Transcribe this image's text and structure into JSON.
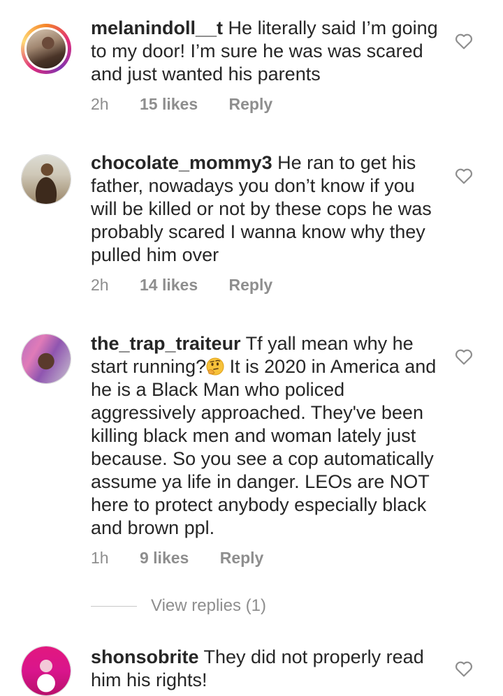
{
  "comments": [
    {
      "username": "melanindoll__t",
      "text": " He literally said I’m going to my door! I’m sure he was was scared and just wanted his parents",
      "time": "2h",
      "likes": "15 likes",
      "reply": "Reply",
      "avatar": "avatar-photo-story-ring"
    },
    {
      "username": "chocolate_mommy3",
      "text": " He ran to get his father, nowadays you don’t know if you will be killed or not by these cops he was probably scared I wanna know why they pulled him over",
      "time": "2h",
      "likes": "14 likes",
      "reply": "Reply",
      "avatar": "avatar-photo"
    },
    {
      "username": "the_trap_traiteur",
      "text_before_emoji": " Tf yall mean why he start running?",
      "emoji": "thinking-face-emoji",
      "text_after_emoji": "  It is 2020 in America and he is a Black Man who policed aggressively approached. They've been killing black men and woman lately just because. So you see a cop automatically assume ya life in danger. LEOs are NOT here to protect anybody especially black and brown ppl.",
      "time": "1h",
      "likes": "9 likes",
      "reply": "Reply",
      "avatar": "avatar-photo"
    },
    {
      "username": "shonsobrite",
      "text": " They did not properly read him his rights!",
      "avatar": "avatar-photo"
    }
  ],
  "view_replies": "View replies (1)",
  "icons": {
    "like": "heart-outline-icon"
  },
  "colors": {
    "text": "#262626",
    "secondary": "#8e8e8e",
    "background": "#ffffff"
  }
}
